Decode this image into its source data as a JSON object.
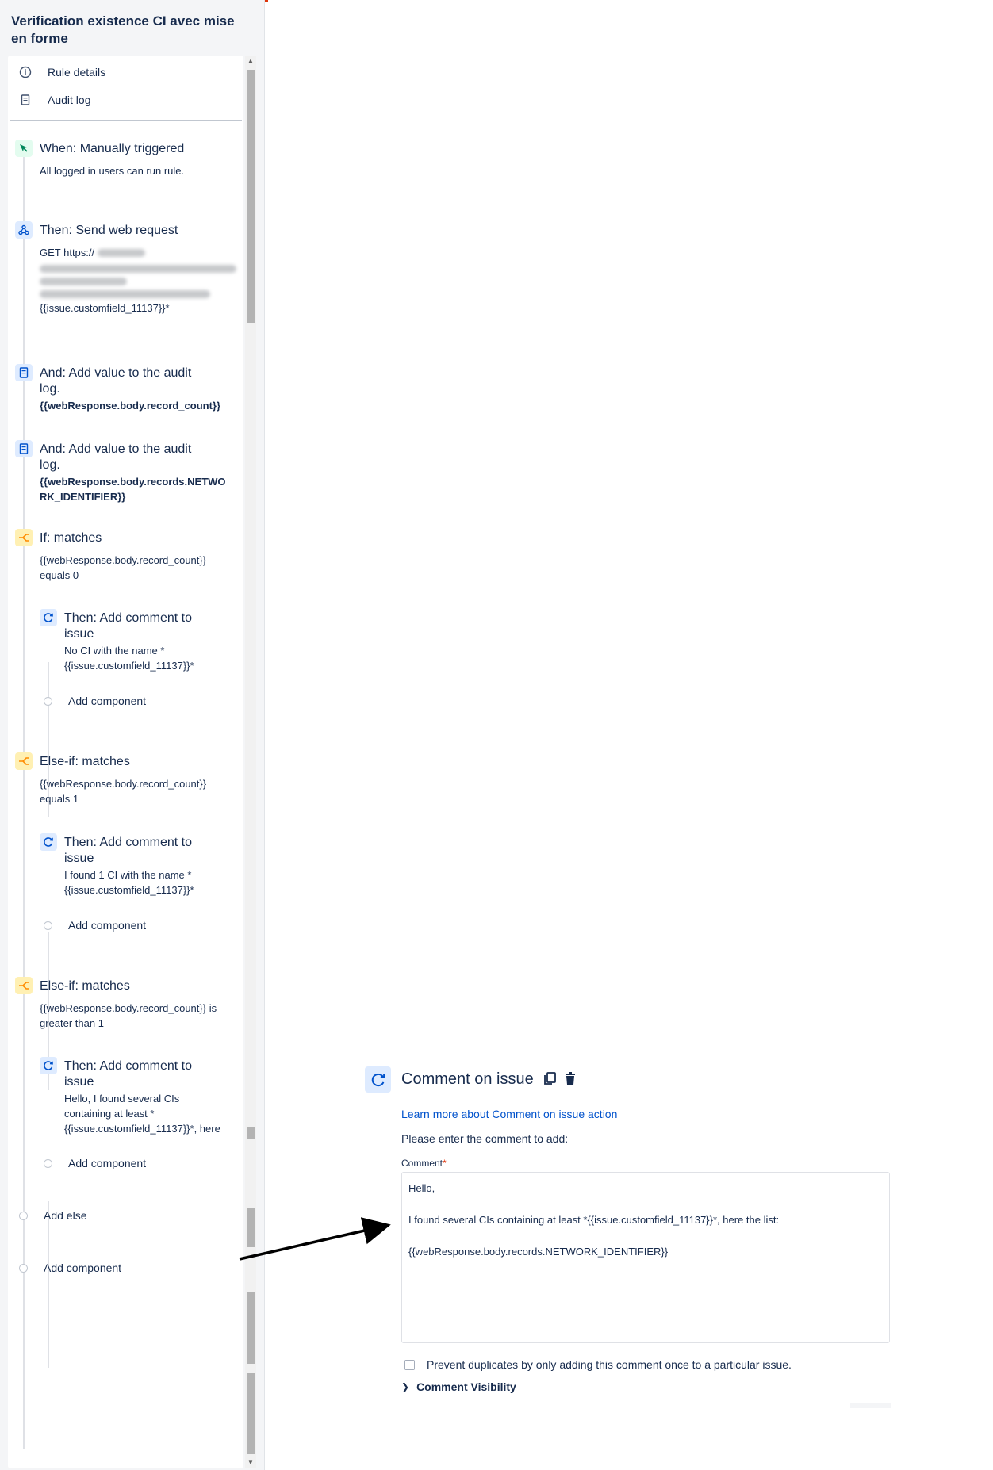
{
  "rule": {
    "title": "Verification existence CI avec mise en forme"
  },
  "nav": {
    "rule_details": "Rule details",
    "audit_log": "Audit log"
  },
  "components": {
    "trigger": {
      "title": "When: Manually triggered",
      "desc": "All logged in users can run rule."
    },
    "web_request": {
      "title": "Then: Send web request",
      "method": "GET https://",
      "field": "{{issue.customfield_11137}}*"
    },
    "audit1": {
      "title_line1": "And: Add value to the audit",
      "title_line2": "log.",
      "value": "{{webResponse.body.record_count}}"
    },
    "audit2": {
      "title_line1": "And: Add value to the audit",
      "title_line2": "log.",
      "value_line1": "{{webResponse.body.records.NETWO",
      "value_line2": "RK_IDENTIFIER}}"
    },
    "if1": {
      "title": "If: matches",
      "cond_line1": "{{webResponse.body.record_count}}",
      "cond_line2": "equals 0"
    },
    "comment1": {
      "title_line1": "Then: Add comment to",
      "title_line2": "issue",
      "desc_line1": "No CI with the name *",
      "desc_line2": "{{issue.customfield_11137}}*"
    },
    "elseif1": {
      "title": "Else-if: matches",
      "cond_line1": "{{webResponse.body.record_count}}",
      "cond_line2": "equals 1"
    },
    "comment2": {
      "title_line1": "Then: Add comment to",
      "title_line2": "issue",
      "desc_line1": "I found 1 CI with the name *",
      "desc_line2": "{{issue.customfield_11137}}*"
    },
    "elseif2": {
      "title": "Else-if: matches",
      "cond_line1": "{{webResponse.body.record_count}} is",
      "cond_line2": "greater than 1"
    },
    "comment3": {
      "title_line1": "Then: Add comment to",
      "title_line2": "issue",
      "desc_line1": "Hello, I found several CIs",
      "desc_line2": "containing at least *",
      "desc_line3": "{{issue.customfield_11137}}*, here"
    }
  },
  "add": {
    "component": "Add component",
    "else": "Add else"
  },
  "comment_panel": {
    "title": "Comment on issue",
    "link": "Learn more about Comment on issue action",
    "description": "Please enter the comment to add:",
    "label": "Comment",
    "required_mark": "*",
    "body": "Hello,\n\nI found several CIs containing at least *{{issue.customfield_11137}}*, here the list:\n\n{{webResponse.body.records.NETWORK_IDENTIFIER}}",
    "prevent_duplicates": "Prevent duplicates by only adding this comment once to a particular issue.",
    "visibility": "Comment Visibility"
  },
  "colors": {
    "link": "#0052cc",
    "text": "#172b4d",
    "trigger": "#00875a",
    "action": "#0052cc",
    "condition": "#ff8b00"
  }
}
